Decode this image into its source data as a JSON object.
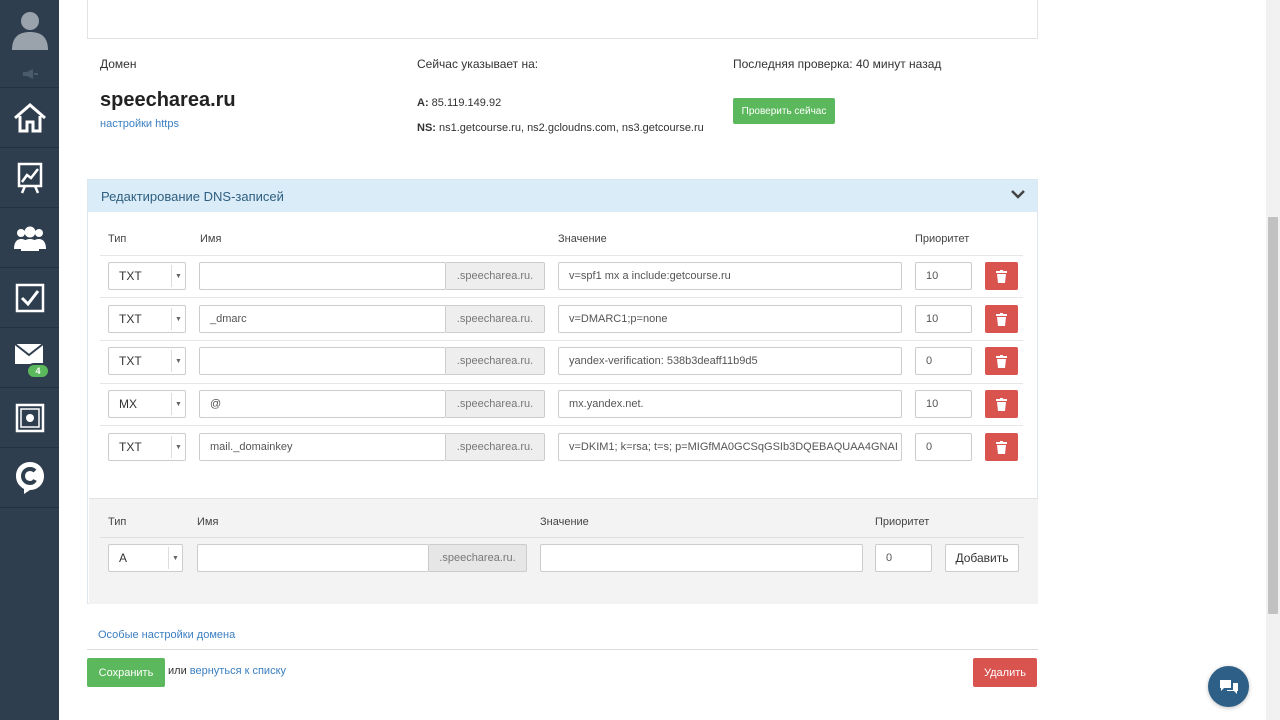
{
  "domain_info": {
    "domain_label": "Домен",
    "domain_name": "speecharea.ru",
    "https_link": "настройки https",
    "points_to_label": "Сейчас указывает на:",
    "a_label": "A:",
    "a_value": "85.119.149.92",
    "ns_label": "NS:",
    "ns_value": "ns1.getcourse.ru, ns2.gcloudns.com, ns3.getcourse.ru",
    "last_check_label": "Последняя проверка: 40 минут назад",
    "check_now_button": "Проверить сейчас"
  },
  "dns_panel": {
    "title": "Редактирование DNS-записей",
    "headers": {
      "type": "Тип",
      "name": "Имя",
      "value": "Значение",
      "priority": "Приоритет"
    },
    "suffix": ".speecharea.ru.",
    "records": [
      {
        "type": "TXT",
        "name": "",
        "value": "v=spf1 mx a include:getcourse.ru",
        "priority": "10"
      },
      {
        "type": "TXT",
        "name": "_dmarc",
        "value": "v=DMARC1;p=none",
        "priority": "10"
      },
      {
        "type": "TXT",
        "name": "",
        "value": "yandex-verification: 538b3deaff11b9d5",
        "priority": "0"
      },
      {
        "type": "MX",
        "name": "@",
        "value": "mx.yandex.net.",
        "priority": "10"
      },
      {
        "type": "TXT",
        "name": "mail._domainkey",
        "value": "v=DKIM1; k=rsa; t=s; p=MIGfMA0GCSqGSIb3DQEBAQUAA4GNAI",
        "priority": "0"
      }
    ],
    "new_record": {
      "headers": {
        "type": "Тип",
        "name": "Имя",
        "value": "Значение",
        "priority": "Приоритет"
      },
      "type": "A",
      "name": "",
      "suffix": ".speecharea.ru.",
      "value": "",
      "priority": "0",
      "add_button": "Добавить"
    }
  },
  "footer": {
    "special_settings_link": "Особые настройки домена",
    "save_button": "Сохранить",
    "or_text": "или",
    "back_link": "вернуться к списку",
    "delete_button": "Удалить"
  },
  "sidebar": {
    "items": [
      {
        "icon": "home-icon"
      },
      {
        "icon": "chart-icon"
      },
      {
        "icon": "users-icon"
      },
      {
        "icon": "tasks-checkbox-icon"
      },
      {
        "icon": "mail-icon",
        "badge": "4"
      },
      {
        "icon": "safe-icon"
      },
      {
        "icon": "getcourse-logo-icon"
      }
    ]
  },
  "colors": {
    "sidebar_bg": "#2f3e4e",
    "accent_green": "#5cb85c",
    "danger_red": "#d9534f",
    "link_blue": "#3a7fc1",
    "panel_head_bg": "#d9ecf7"
  }
}
